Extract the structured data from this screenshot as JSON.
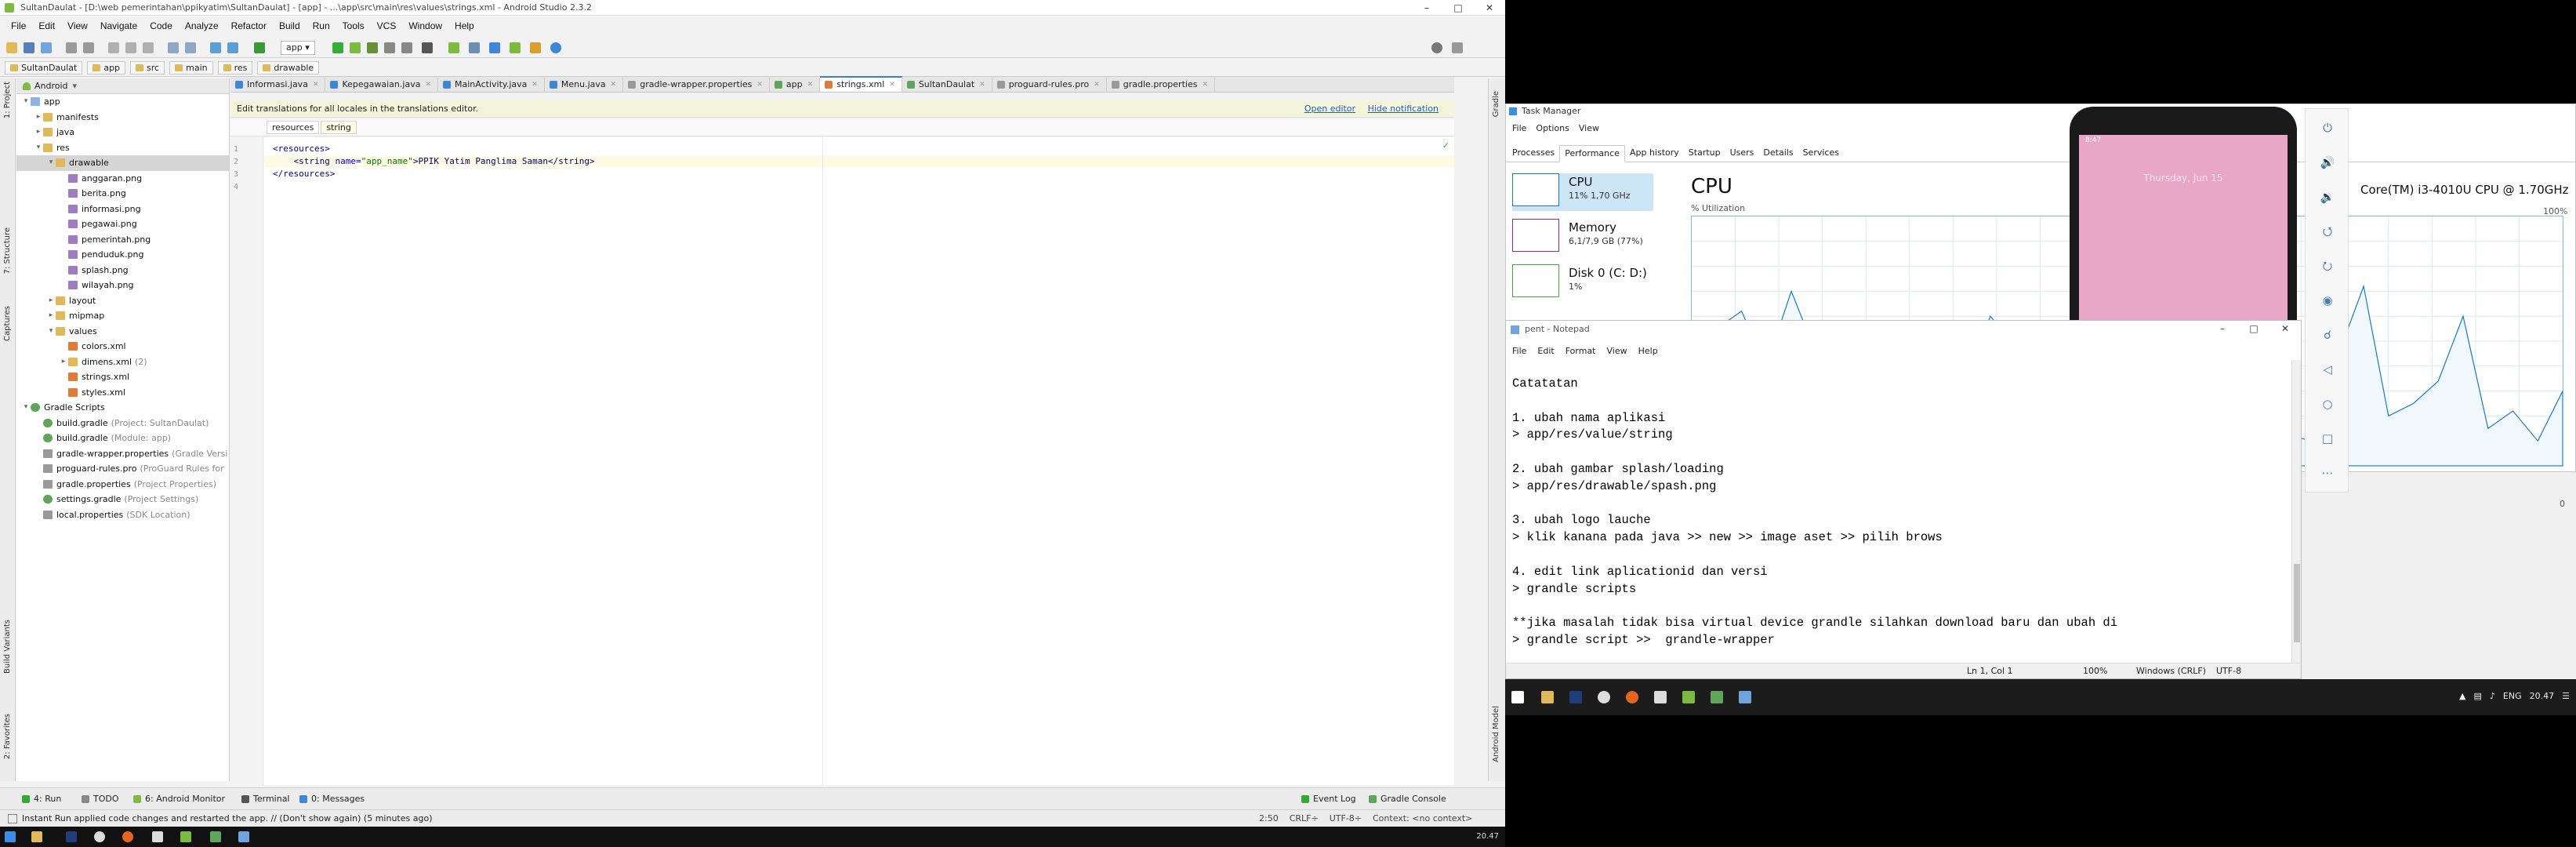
{
  "android_studio": {
    "window_title": "SultanDaulat - [D:\\web pemerintahan\\ppikyatim\\SultanDaulat] - [app] - ...\\app\\src\\main\\res\\values\\strings.xml - Android Studio 2.3.2",
    "menu": [
      "File",
      "Edit",
      "View",
      "Navigate",
      "Code",
      "Analyze",
      "Refactor",
      "Build",
      "Run",
      "Tools",
      "VCS",
      "Window",
      "Help"
    ],
    "run_config": "app",
    "nav_crumbs": [
      "SultanDaulat",
      "app",
      "src",
      "main",
      "res",
      "drawable"
    ],
    "left_strip": [
      "1: Project",
      "7: Structure",
      "Captures",
      "Build Variants",
      "2: Favorites"
    ],
    "right_strip": [
      "Gradle",
      "Android Model"
    ],
    "project_view": "Android",
    "tree": [
      {
        "label": "app",
        "depth": 0,
        "arrow": "down",
        "icon": "folder blue",
        "hint": ""
      },
      {
        "label": "manifests",
        "depth": 1,
        "arrow": "right",
        "icon": "folder",
        "hint": ""
      },
      {
        "label": "java",
        "depth": 1,
        "arrow": "right",
        "icon": "folder",
        "hint": ""
      },
      {
        "label": "res",
        "depth": 1,
        "arrow": "down",
        "icon": "folder",
        "hint": ""
      },
      {
        "label": "drawable",
        "depth": 2,
        "arrow": "down",
        "icon": "folder",
        "hint": "",
        "selected": true
      },
      {
        "label": "anggaran.png",
        "depth": 3,
        "arrow": "",
        "icon": "img",
        "hint": ""
      },
      {
        "label": "berita.png",
        "depth": 3,
        "arrow": "",
        "icon": "img",
        "hint": ""
      },
      {
        "label": "informasi.png",
        "depth": 3,
        "arrow": "",
        "icon": "img",
        "hint": ""
      },
      {
        "label": "pegawai.png",
        "depth": 3,
        "arrow": "",
        "icon": "img",
        "hint": ""
      },
      {
        "label": "pemerintah.png",
        "depth": 3,
        "arrow": "",
        "icon": "img",
        "hint": ""
      },
      {
        "label": "penduduk.png",
        "depth": 3,
        "arrow": "",
        "icon": "img",
        "hint": ""
      },
      {
        "label": "splash.png",
        "depth": 3,
        "arrow": "",
        "icon": "img",
        "hint": ""
      },
      {
        "label": "wilayah.png",
        "depth": 3,
        "arrow": "",
        "icon": "img",
        "hint": ""
      },
      {
        "label": "layout",
        "depth": 2,
        "arrow": "right",
        "icon": "folder",
        "hint": ""
      },
      {
        "label": "mipmap",
        "depth": 2,
        "arrow": "right",
        "icon": "folder",
        "hint": ""
      },
      {
        "label": "values",
        "depth": 2,
        "arrow": "down",
        "icon": "folder",
        "hint": ""
      },
      {
        "label": "colors.xml",
        "depth": 3,
        "arrow": "",
        "icon": "xml",
        "hint": ""
      },
      {
        "label": "dimens.xml",
        "depth": 3,
        "arrow": "right",
        "icon": "folder",
        "hint": "(2)"
      },
      {
        "label": "strings.xml",
        "depth": 3,
        "arrow": "",
        "icon": "xml",
        "hint": ""
      },
      {
        "label": "styles.xml",
        "depth": 3,
        "arrow": "",
        "icon": "xml",
        "hint": ""
      },
      {
        "label": "Gradle Scripts",
        "depth": 0,
        "arrow": "down",
        "icon": "gradle",
        "hint": ""
      },
      {
        "label": "build.gradle",
        "depth": 1,
        "arrow": "",
        "icon": "gradle",
        "hint": "(Project: SultanDaulat)"
      },
      {
        "label": "build.gradle",
        "depth": 1,
        "arrow": "",
        "icon": "gradle",
        "hint": "(Module: app)"
      },
      {
        "label": "gradle-wrapper.properties",
        "depth": 1,
        "arrow": "",
        "icon": "props",
        "hint": "(Gradle Versi"
      },
      {
        "label": "proguard-rules.pro",
        "depth": 1,
        "arrow": "",
        "icon": "props",
        "hint": "(ProGuard Rules for"
      },
      {
        "label": "gradle.properties",
        "depth": 1,
        "arrow": "",
        "icon": "props",
        "hint": "(Project Properties)"
      },
      {
        "label": "settings.gradle",
        "depth": 1,
        "arrow": "",
        "icon": "gradle",
        "hint": "(Project Settings)"
      },
      {
        "label": "local.properties",
        "depth": 1,
        "arrow": "",
        "icon": "props",
        "hint": "(SDK Location)"
      }
    ],
    "editor_tabs": [
      {
        "label": "Informasi.java",
        "color": "#3f86d6"
      },
      {
        "label": "Kepegawaian.java",
        "color": "#3f86d6"
      },
      {
        "label": "MainActivity.java",
        "color": "#3f86d6"
      },
      {
        "label": "Menu.java",
        "color": "#3f86d6"
      },
      {
        "label": "gradle-wrapper.properties",
        "color": "#9a9a9a"
      },
      {
        "label": "app",
        "color": "#5fa55a"
      },
      {
        "label": "strings.xml",
        "color": "#e07b39",
        "active": true
      },
      {
        "label": "SultanDaulat",
        "color": "#5fa55a"
      },
      {
        "label": "proguard-rules.pro",
        "color": "#9a9a9a"
      },
      {
        "label": "gradle.properties",
        "color": "#9a9a9a"
      }
    ],
    "notification": {
      "text": "Edit translations for all locales in the translations editor.",
      "open_editor": "Open editor",
      "hide": "Hide notification"
    },
    "xml_crumbs": [
      "resources",
      "string"
    ],
    "code": {
      "line_numbers": [
        "1",
        "2",
        "3",
        "4"
      ],
      "l1": "<resources>",
      "l2_open": "    <string ",
      "l2_attr": "name=",
      "l2_attrval": "\"app_name\"",
      "l2_text": ">PPIK Yatim Panglima Saman</string>",
      "l3": "</resources>"
    },
    "bottom_tools": [
      {
        "label": "4: Run",
        "color": "#3a3"
      },
      {
        "label": "TODO",
        "color": "#888"
      },
      {
        "label": "6: Android Monitor",
        "color": "#7dba40"
      },
      {
        "label": "Terminal",
        "color": "#555"
      },
      {
        "label": "0: Messages",
        "color": "#3f86d6"
      }
    ],
    "bottom_tools_right": [
      {
        "label": "Event Log",
        "color": "#3a3"
      },
      {
        "label": "Gradle Console",
        "color": "#5fa55a"
      }
    ],
    "status_message": "Instant Run applied code changes and restarted the app. // (Don't show again) (5 minutes ago)",
    "status_right": [
      "2:50",
      "CRLF÷",
      "UTF-8÷",
      "Context: <no context>"
    ]
  },
  "taskbar_left": {
    "clock": "20.47"
  },
  "task_manager": {
    "title": "Task Manager",
    "menu": [
      "File",
      "Options",
      "View"
    ],
    "tabs": [
      "Processes",
      "Performance",
      "App history",
      "Startup",
      "Users",
      "Details",
      "Services"
    ],
    "active_tab": "Performance",
    "items": [
      {
        "name": "CPU",
        "sub": "11% 1,70 GHz",
        "color": "#1a79c5",
        "selected": true
      },
      {
        "name": "Memory",
        "sub": "6,1/7,9 GB (77%)",
        "color": "#8b2a8b"
      },
      {
        "name": "Disk 0 (C: D:)",
        "sub": "1%",
        "color": "#4da33e"
      }
    ],
    "cpu_heading": "CPU",
    "util_label": "% Utilization",
    "cpu_model": "Core(TM) i3-4010U CPU @ 1.70GHz",
    "pct_top": "100%",
    "pct_bottom": "0",
    "utilization_history": [
      30,
      55,
      62,
      40,
      70,
      45,
      20,
      35,
      28,
      50,
      44,
      33,
      60,
      48,
      22,
      30,
      26,
      55,
      30,
      40,
      38,
      52,
      35,
      18,
      12,
      10,
      45,
      72,
      20,
      25,
      34,
      60,
      15,
      22,
      10,
      30
    ]
  },
  "emulator": {
    "status_time": "8:47",
    "date_text": "Thursday, Jun 15"
  },
  "notepad": {
    "title": "pent - Notepad",
    "menu": [
      "File",
      "Edit",
      "Format",
      "View",
      "Help"
    ],
    "lines": [
      "Catatatan",
      "",
      "1. ubah nama aplikasi",
      "> app/res/value/string",
      "",
      "2. ubah gambar splash/loading",
      "> app/res/drawable/spash.png",
      "",
      "3. ubah logo lauche",
      "> klik kanana pada java >> new >> image aset >> pilih brows",
      "",
      "4. edit link aplicationid dan versi",
      "> grandle scripts",
      "",
      "**jika masalah tidak bisa virtual device grandle silahkan download baru dan ubah di",
      "> grandle script >>  grandle-wrapper"
    ],
    "status": {
      "pos": "Ln 1, Col 1",
      "zoom": "100%",
      "eol": "Windows (CRLF)",
      "enc": "UTF-8"
    }
  },
  "taskbar_right": {
    "lang": "ENG",
    "clock": "20.47"
  }
}
